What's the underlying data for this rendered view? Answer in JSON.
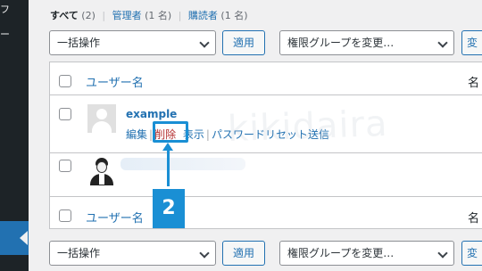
{
  "sidebar": {
    "fragment_top": "フ",
    "fragment_mid": "ー"
  },
  "views": {
    "all_label": "すべて",
    "all_count": "(2)",
    "admin_label": "管理者",
    "admin_count": "(1 名)",
    "subscriber_label": "購読者",
    "subscriber_count": "(1 名)",
    "separator": "|"
  },
  "top_actions": {
    "bulk_select": "一括操作",
    "apply": "適用",
    "role_select": "権限グループを変更…",
    "change_partial": "変"
  },
  "table": {
    "header_username": "ユーザー名",
    "header_name_partial": "名",
    "footer_username": "ユーザー名",
    "footer_name_partial": "名",
    "rows": [
      {
        "username": "example",
        "name_partial": "",
        "actions": {
          "edit": "編集",
          "delete": "削除",
          "view": "表示",
          "reset": "パスワードリセット送信"
        }
      }
    ]
  },
  "bottom_actions": {
    "bulk_select": "一括操作",
    "apply": "適用",
    "role_select": "権限グループを変更…",
    "change_partial": "変"
  },
  "annotation": {
    "step": "2",
    "watermark": "kikidaira"
  },
  "colors": {
    "accent": "#2271b1",
    "delete": "#b32d2e",
    "annotation": "#1a8fd4"
  }
}
